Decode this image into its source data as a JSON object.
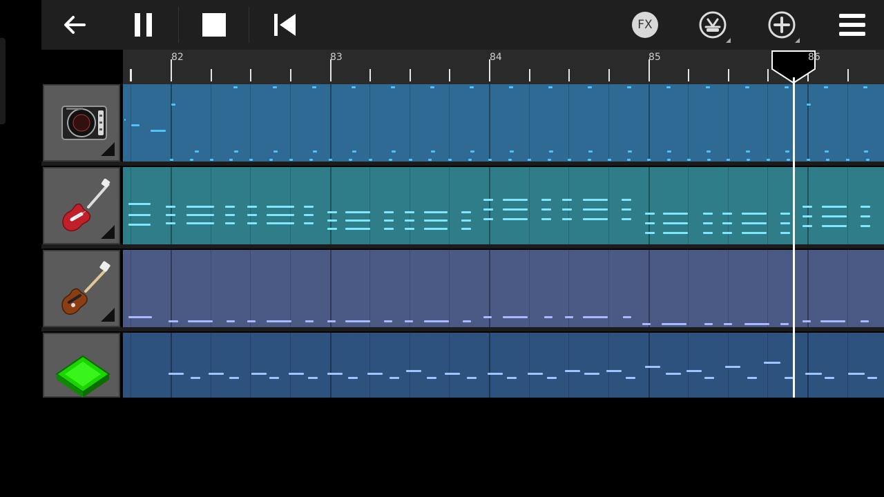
{
  "toolbar": {
    "back": "back-arrow-icon",
    "pause": "pause-icon",
    "stop": "stop-icon",
    "rewind": "skip-to-start-icon",
    "fx_label": "FX",
    "metronome": "metronome-icon",
    "add": "add-track-icon",
    "menu": "hamburger-menu-icon"
  },
  "ruler": {
    "bars": [
      "82",
      "83",
      "84",
      "85",
      "86"
    ]
  },
  "tracks": [
    {
      "name": "drum-machine-track",
      "icon": "drum-machine-icon",
      "color": "#2e6a93",
      "note_color": "#4fc3f7"
    },
    {
      "name": "electric-guitar-track",
      "icon": "electric-guitar-icon",
      "color": "#2f7d88",
      "note_color": "#7fe6ff"
    },
    {
      "name": "bass-guitar-track",
      "icon": "bass-guitar-icon",
      "color": "#4a5a85",
      "note_color": "#a9b9ff"
    },
    {
      "name": "synth-pad-track",
      "icon": "green-gem-icon",
      "color": "#2d527d",
      "note_color": "#9ec5ff"
    }
  ],
  "colors": {
    "toolbar": "#1f1f1f",
    "ruler": "#2a2a2a",
    "playhead": "#ffffff"
  }
}
